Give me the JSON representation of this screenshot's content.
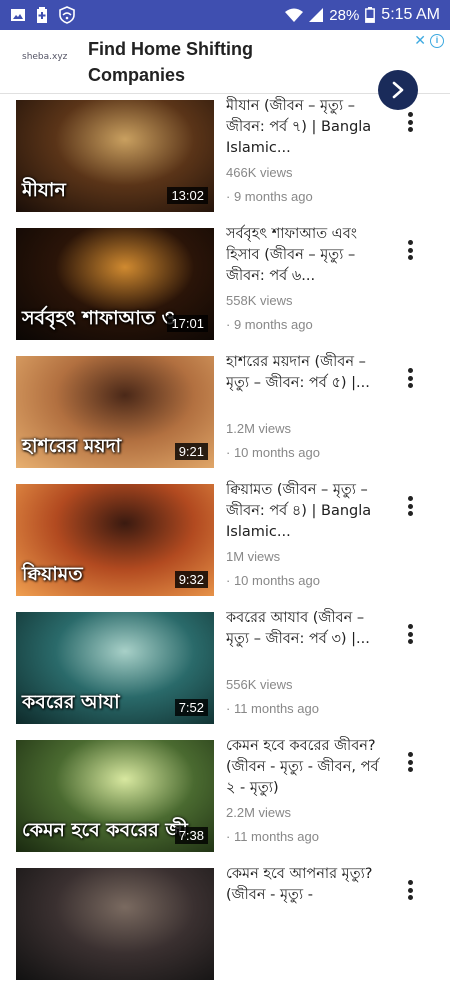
{
  "status_bar": {
    "battery": "28%",
    "time": "5:15 AM",
    "icons": [
      "gallery-icon",
      "battery-saver-icon",
      "shield-wifi-icon",
      "wifi-icon",
      "signal-icon",
      "battery-icon"
    ]
  },
  "ad": {
    "brand": "sheba.xyz",
    "title": "Find Home Shifting Companies",
    "info_icon": "adchoices-icon",
    "close_icon": "close-icon"
  },
  "videos": [
    {
      "title": "মীযান (জীবন – মৃত্যু – জীবন: পর্ব ৭) | Bangla Islamic...",
      "views": "466K views",
      "ago": "· 9 months ago",
      "duration": "13:02",
      "caption": "মীযান",
      "colors": [
        "#1a0e08",
        "#5a3418",
        "#c9a060"
      ]
    },
    {
      "title": "সর্ববৃহৎ শাফাআত এবং হিসাব (জীবন – মৃত্যু – জীবন: পর্ব ৬...",
      "views": "558K views",
      "ago": "· 9 months ago",
      "duration": "17:01",
      "caption": "সর্ববৃহৎ শাফাআত ও",
      "colors": [
        "#0a0604",
        "#2a1408",
        "#d08a30"
      ]
    },
    {
      "title": "হাশরের ময়দান (জীবন – মৃত্যু – জীবন: পর্ব ৫) |...",
      "views": "1.2M views",
      "ago": "· 10 months ago",
      "duration": "9:21",
      "caption": "হাশরের ময়দা",
      "colors": [
        "#e8b070",
        "#b27040",
        "#4a2818"
      ]
    },
    {
      "title": "ক্বিয়ামত (জীবন – মৃত্যু – জীবন: পর্ব ৪) | Bangla Islamic...",
      "views": "1M views",
      "ago": "· 10 months ago",
      "duration": "9:32",
      "caption": "ক্বিয়ামত",
      "colors": [
        "#f0a050",
        "#b24a20",
        "#3a1a10"
      ]
    },
    {
      "title": "কবরের আযাব (জীবন – মৃত্যু – জীবন: পর্ব ৩) |...",
      "views": "556K views",
      "ago": "· 11 months ago",
      "duration": "7:52",
      "caption": "কবরের আযা",
      "colors": [
        "#0e2a2a",
        "#2a6a6a",
        "#a8d0c8"
      ]
    },
    {
      "title": "কেমন হবে কবরের জীবন? (জীবন - মৃত্যু - জীবন, পর্ব ২ - মৃত্যু)",
      "views": "2.2M views",
      "ago": "· 11 months ago",
      "duration": "7:38",
      "caption": "কেমন হবে কবরের জী",
      "colors": [
        "#1a2a10",
        "#4a6a30",
        "#d8e8a0"
      ]
    },
    {
      "title": "কেমন হবে আপনার মৃত্যু? (জীবন - মৃত্যু -",
      "views": "",
      "ago": "",
      "duration": "",
      "caption": "",
      "colors": [
        "#111111",
        "#3a3030",
        "#7a6a60"
      ]
    }
  ]
}
